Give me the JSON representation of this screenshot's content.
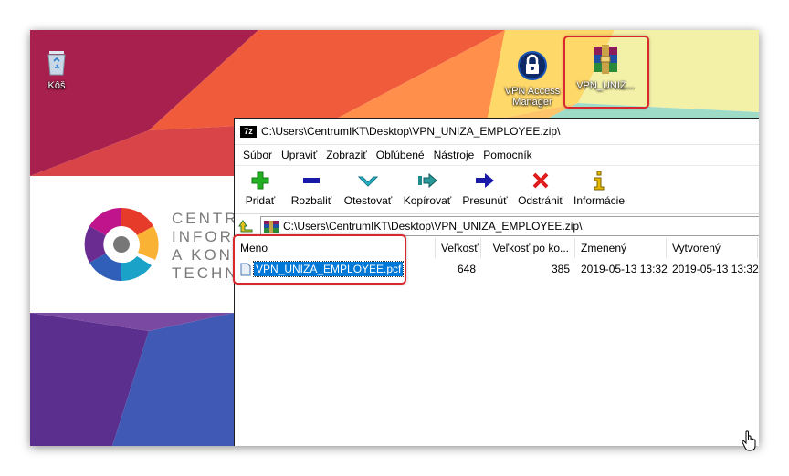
{
  "desktop": {
    "recycle_bin_label": "Kôš",
    "vpn_manager_label": "VPN Access Manager",
    "archive_label": "VPN_UNIZ...",
    "brand_lines": [
      "CENTR",
      "INFOR",
      "A KON",
      "TECHN"
    ]
  },
  "window": {
    "title": "C:\\Users\\CentrumIKT\\Desktop\\VPN_UNIZA_EMPLOYEE.zip\\",
    "app_icon_text": "7z",
    "menu": [
      "Súbor",
      "Upraviť",
      "Zobraziť",
      "Obľúbené",
      "Nástroje",
      "Pomocník"
    ],
    "toolbar": [
      {
        "label": "Pridať",
        "icon": "plus-icon",
        "color": "#22b022"
      },
      {
        "label": "Rozbaliť",
        "icon": "minus-icon",
        "color": "#1a1aa8"
      },
      {
        "label": "Otestovať",
        "icon": "check-icon",
        "color": "#27b7c9"
      },
      {
        "label": "Kopírovať",
        "icon": "copy-arrow-icon",
        "color": "#1e8a8a"
      },
      {
        "label": "Presunúť",
        "icon": "move-arrow-icon",
        "color": "#1a1aa8"
      },
      {
        "label": "Odstrániť",
        "icon": "delete-x-icon",
        "color": "#e01b1b"
      },
      {
        "label": "Informácie",
        "icon": "info-icon",
        "color": "#e6b800"
      }
    ],
    "address": "C:\\Users\\CentrumIKT\\Desktop\\VPN_UNIZA_EMPLOYEE.zip\\",
    "columns": [
      "Meno",
      "Veľkosť",
      "Veľkosť po ko...",
      "Zmenený",
      "Vytvorený"
    ],
    "files": [
      {
        "name": "VPN_UNIZA_EMPLOYEE.pcf",
        "size": "648",
        "packed": "385",
        "modified": "2019-05-13 13:32",
        "created": "2019-05-13 13:32"
      }
    ]
  },
  "colors": {
    "highlight": "#d9272e",
    "selection": "#0078d7"
  }
}
